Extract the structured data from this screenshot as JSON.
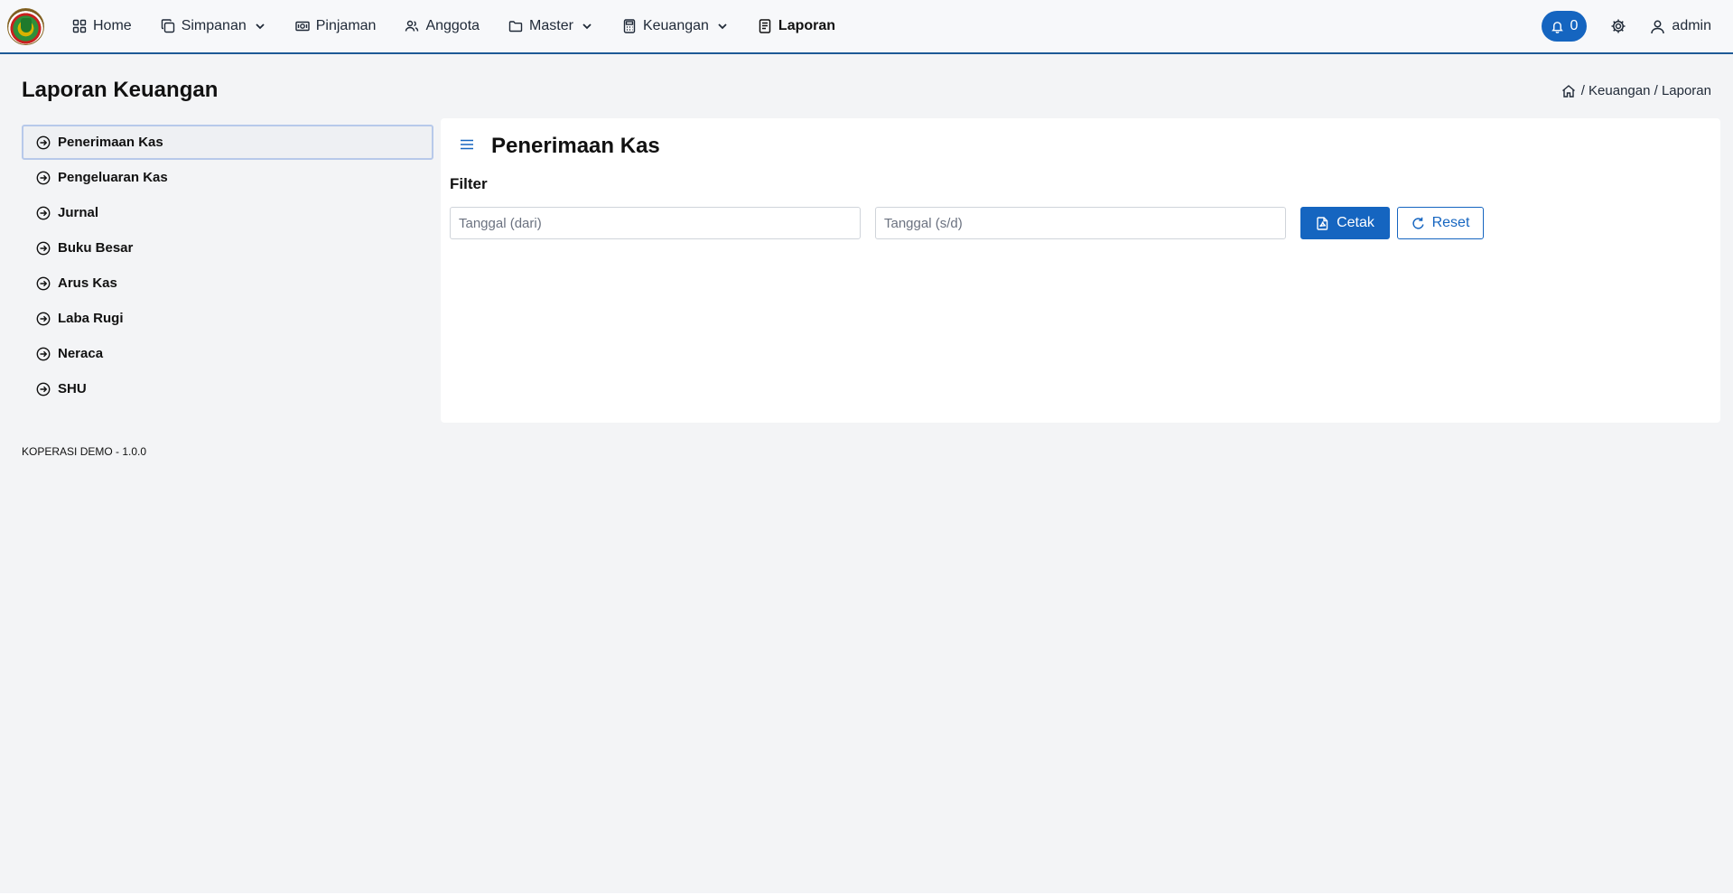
{
  "navbar": {
    "items": [
      {
        "label": "Home",
        "icon": "grid-icon",
        "dropdown": false,
        "active": false
      },
      {
        "label": "Simpanan",
        "icon": "copy-icon",
        "dropdown": true,
        "active": false
      },
      {
        "label": "Pinjaman",
        "icon": "money-icon",
        "dropdown": false,
        "active": false
      },
      {
        "label": "Anggota",
        "icon": "users-icon",
        "dropdown": false,
        "active": false
      },
      {
        "label": "Master",
        "icon": "folder-icon",
        "dropdown": true,
        "active": false
      },
      {
        "label": "Keuangan",
        "icon": "calculator-icon",
        "dropdown": true,
        "active": false
      },
      {
        "label": "Laporan",
        "icon": "report-icon",
        "dropdown": false,
        "active": true
      }
    ],
    "notification_count": "0",
    "user_name": "admin"
  },
  "page": {
    "title": "Laporan Keuangan",
    "breadcrumb": "/ Keuangan / Laporan"
  },
  "sidebar": {
    "items": [
      {
        "label": "Penerimaan Kas",
        "selected": true
      },
      {
        "label": "Pengeluaran Kas",
        "selected": false
      },
      {
        "label": "Jurnal",
        "selected": false
      },
      {
        "label": "Buku Besar",
        "selected": false
      },
      {
        "label": "Arus Kas",
        "selected": false
      },
      {
        "label": "Laba Rugi",
        "selected": false
      },
      {
        "label": "Neraca",
        "selected": false
      },
      {
        "label": "SHU",
        "selected": false
      }
    ]
  },
  "panel": {
    "title": "Penerimaan Kas",
    "filter_label": "Filter",
    "date_from_placeholder": "Tanggal (dari)",
    "date_to_placeholder": "Tanggal (s/d)",
    "print_label": "Cetak",
    "reset_label": "Reset"
  },
  "footer": {
    "text": "KOPERASI DEMO - 1.0.0"
  },
  "colors": {
    "primary": "#1565c0",
    "navbar_border": "#1d5a96",
    "background": "#f3f4f6"
  }
}
